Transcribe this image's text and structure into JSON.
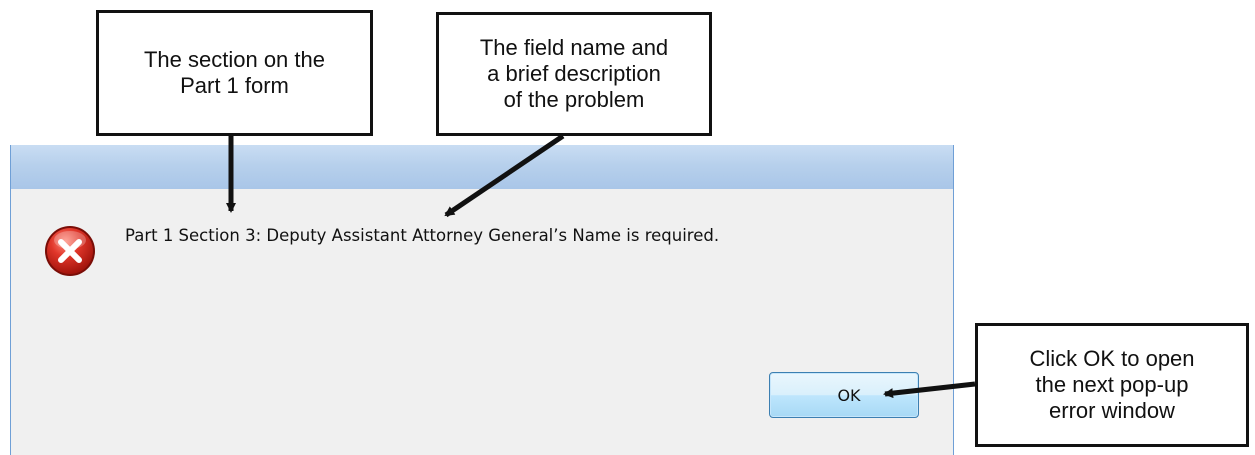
{
  "dialog": {
    "message": "Part 1 Section 3: Deputy Assistant Attorney General’s Name is required.",
    "ok_label": "OK",
    "icon": "error-icon"
  },
  "callouts": {
    "section": [
      "The section on the",
      "Part 1 form"
    ],
    "field": [
      "The field name and",
      "a brief description",
      "of the problem"
    ],
    "ok": [
      "Click OK to open",
      "the next pop-up",
      "error window"
    ]
  }
}
